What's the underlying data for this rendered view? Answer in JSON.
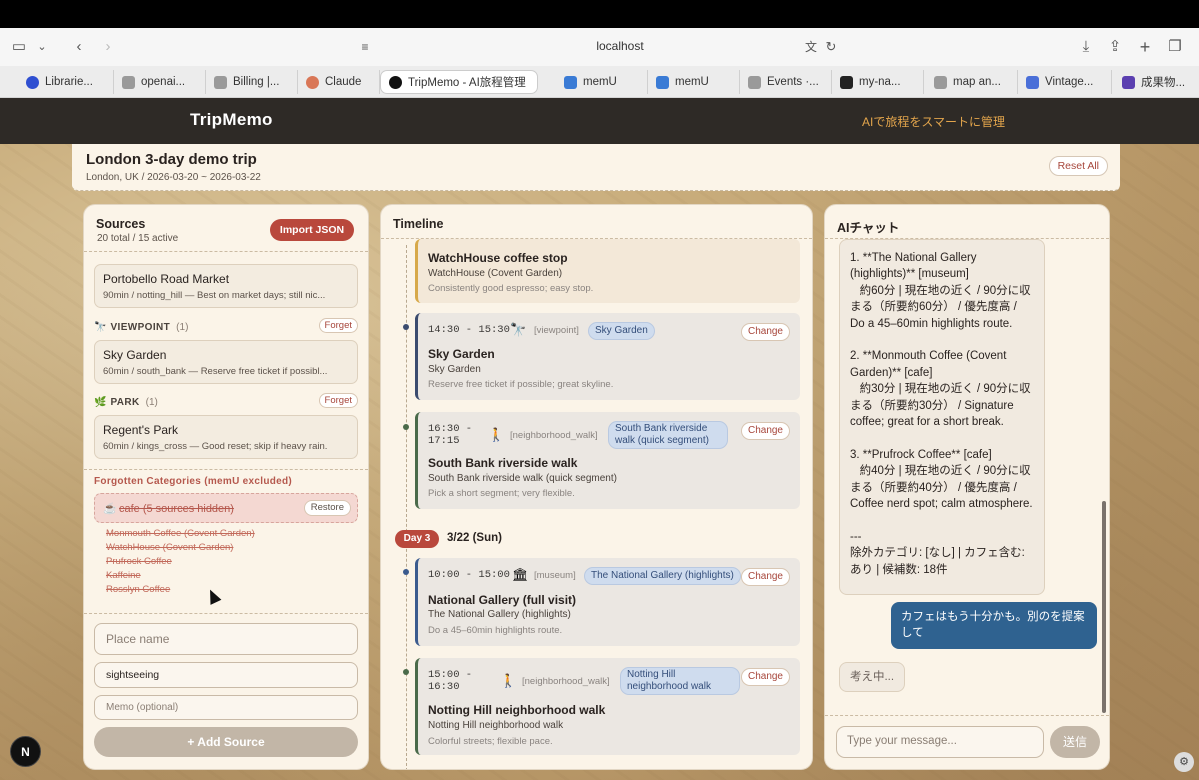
{
  "browser": {
    "url": "localhost",
    "tabs": [
      {
        "label": "Librarie...",
        "color": "#2f4fd1"
      },
      {
        "label": "openai...",
        "color": "#9a9a9a"
      },
      {
        "label": "Billing |...",
        "color": "#9a9a9a"
      },
      {
        "label": "Claude",
        "color": "#d97757"
      },
      {
        "label": "TripMemo - AI旅程管理",
        "color": "#111111"
      },
      {
        "label": "memU",
        "color": "#3a7bd5"
      },
      {
        "label": "memU",
        "color": "#3a7bd5"
      },
      {
        "label": "Events ·...",
        "color": "#9a9a9a"
      },
      {
        "label": "my-na...",
        "color": "#222222"
      },
      {
        "label": "map an...",
        "color": "#9a9a9a"
      },
      {
        "label": "Vintage...",
        "color": "#4a6fd8"
      },
      {
        "label": "成果物...",
        "color": "#5b3fb0"
      }
    ]
  },
  "app": {
    "brand": "TripMemo",
    "tagline": "AIで旅程をスマートに管理"
  },
  "trip": {
    "title": "London 3-day demo trip",
    "subtitle": "London, UK / 2026-03-20 ~ 2026-03-22",
    "reset_label": "Reset All"
  },
  "sources": {
    "heading": "Sources",
    "count": "20 total / 15 active",
    "import_label": "Import JSON",
    "cards": [
      {
        "name": "Portobello Road Market",
        "meta": "90min / notting_hill — Best on market days; still nic..."
      },
      {
        "name": "Sky Garden",
        "meta": "60min / south_bank — Reserve free ticket if possibl..."
      },
      {
        "name": "Regent's Park",
        "meta": "60min / kings_cross — Good reset; skip if heavy rain."
      }
    ],
    "categories": [
      {
        "icon": "🔭",
        "name": "VIEWPOINT",
        "count": "(1)",
        "forget": "Forget"
      },
      {
        "icon": "🌿",
        "name": "PARK",
        "count": "(1)",
        "forget": "Forget"
      }
    ],
    "forgotten_heading": "Forgotten Categories (memU excluded)",
    "hidden_category": "cafe (5 sources hidden)",
    "restore_label": "Restore",
    "hidden_items": [
      "Monmouth Coffee (Covent Garden)",
      "WatchHouse (Covent Garden)",
      "Prufrock Coffee",
      "Kaffeine",
      "Rosslyn Coffee"
    ],
    "form": {
      "place_placeholder": "Place name",
      "category_value": "sightseeing",
      "memo_placeholder": "Memo (optional)",
      "add_label": "+ Add Source"
    }
  },
  "timeline": {
    "heading": "Timeline",
    "events": [
      {
        "title": "WatchHouse coffee stop",
        "place": "WatchHouse (Covent Garden)",
        "note": "Consistently good espresso; easy stop.",
        "color": "#d7a94a",
        "bg": "#f3e8d8"
      },
      {
        "time": "14:30 - 15:30",
        "icon": "🔭",
        "kind": "[viewpoint]",
        "pill": "Sky Garden",
        "change": "Change",
        "title": "Sky Garden",
        "place": "Sky Garden",
        "note": "Reserve free ticket if possible; great skyline.",
        "color": "#3b4b6e"
      },
      {
        "time": "16:30 -\n17:15",
        "icon": "🚶",
        "kind": "[neighborhood_walk]",
        "pill": "South Bank riverside walk (quick segment)",
        "change": "Change",
        "title": "South Bank riverside walk",
        "place": "South Bank riverside walk (quick segment)",
        "note": "Pick a short segment; very flexible.",
        "color": "#4a6a4a"
      },
      {
        "time": "10:00 - 15:00",
        "icon": "🏛",
        "kind": "[museum]",
        "pill": "The National Gallery (highlights)",
        "change": "Change",
        "title": "National Gallery (full visit)",
        "place": "The National Gallery (highlights)",
        "note": "Do a 45–60min highlights route.",
        "color": "#3b5b8e"
      },
      {
        "time": "15:00 -\n16:30",
        "icon": "🚶",
        "kind": "[neighborhood_walk]",
        "pill": "Notting Hill neighborhood walk",
        "change": "Change",
        "title": "Notting Hill neighborhood walk",
        "place": "Notting Hill neighborhood walk",
        "note": "Colorful streets; flexible pace.",
        "color": "#4a6a4a"
      }
    ],
    "day3": {
      "badge": "Day 3",
      "date": "3/22 (Sun)"
    }
  },
  "chat": {
    "heading": "AIチャット",
    "bot_message": "1. **The National Gallery (highlights)** [museum]\n   約60分 | 現在地の近く / 90分に収まる（所要約60分） / 優先度高 / Do a 45–60min highlights route.\n\n2. **Monmouth Coffee (Covent Garden)** [cafe]\n   約30分 | 現在地の近く / 90分に収まる（所要約30分） / Signature coffee; great for a short break.\n\n3. **Prufrock Coffee** [cafe]\n   約40分 | 現在地の近く / 90分に収まる（所要約40分） / 優先度高 / Coffee nerd spot; calm atmosphere.\n\n---\n除外カテゴリ: [なし] | カフェ含む: あり | 候補数: 18件",
    "user_message": "カフェはもう十分かも。別のを提案して",
    "thinking": "考え中...",
    "input_placeholder": "Type your message...",
    "send_label": "送信"
  },
  "misc": {
    "n_badge": "N"
  }
}
